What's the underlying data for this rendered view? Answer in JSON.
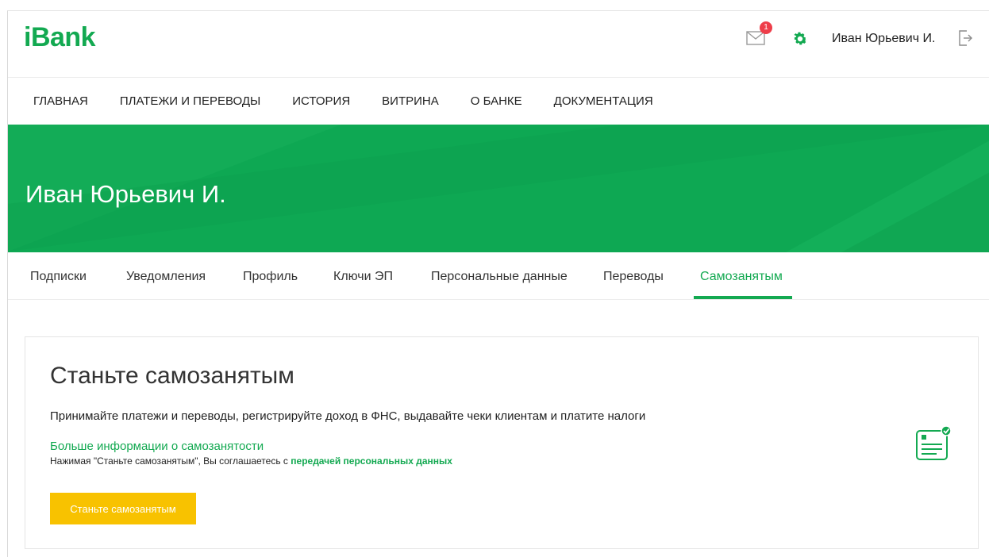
{
  "header": {
    "logo": "iBank",
    "mail_badge": "1",
    "user_name": "Иван Юрьевич И."
  },
  "main_nav": {
    "items": [
      "ГЛАВНАЯ",
      "ПЛАТЕЖИ И ПЕРЕВОДЫ",
      "ИСТОРИЯ",
      "ВИТРИНА",
      "О БАНКЕ",
      "ДОКУМЕНТАЦИЯ"
    ]
  },
  "banner": {
    "title": "Иван Юрьевич И."
  },
  "tabs": {
    "items": [
      "Подписки",
      "Уведомления",
      "Профиль",
      "Ключи ЭП",
      "Персональные данные",
      "Переводы",
      "Самозанятым"
    ],
    "active": "Самозанятым"
  },
  "card": {
    "title": "Станьте самозанятым",
    "description": "Принимайте платежи и переводы, регистрируйте доход в ФНС, выдавайте чеки клиентам и платите налоги",
    "info_link": "Больше информации о самозанятости",
    "consent_prefix": "Нажимая \"Станьте самозанятым\", Вы соглашаетесь с ",
    "consent_link": "передачей персональных данных",
    "button_label": "Станьте самозанятым"
  },
  "icons": {
    "mail": "mail-icon",
    "settings": "gear-icon",
    "logout": "logout-icon",
    "document": "document-check-icon"
  },
  "colors": {
    "brand_green": "#13a951",
    "banner_green": "#0ea853",
    "button_yellow": "#f8c200",
    "badge_red": "#ee3e4a"
  }
}
